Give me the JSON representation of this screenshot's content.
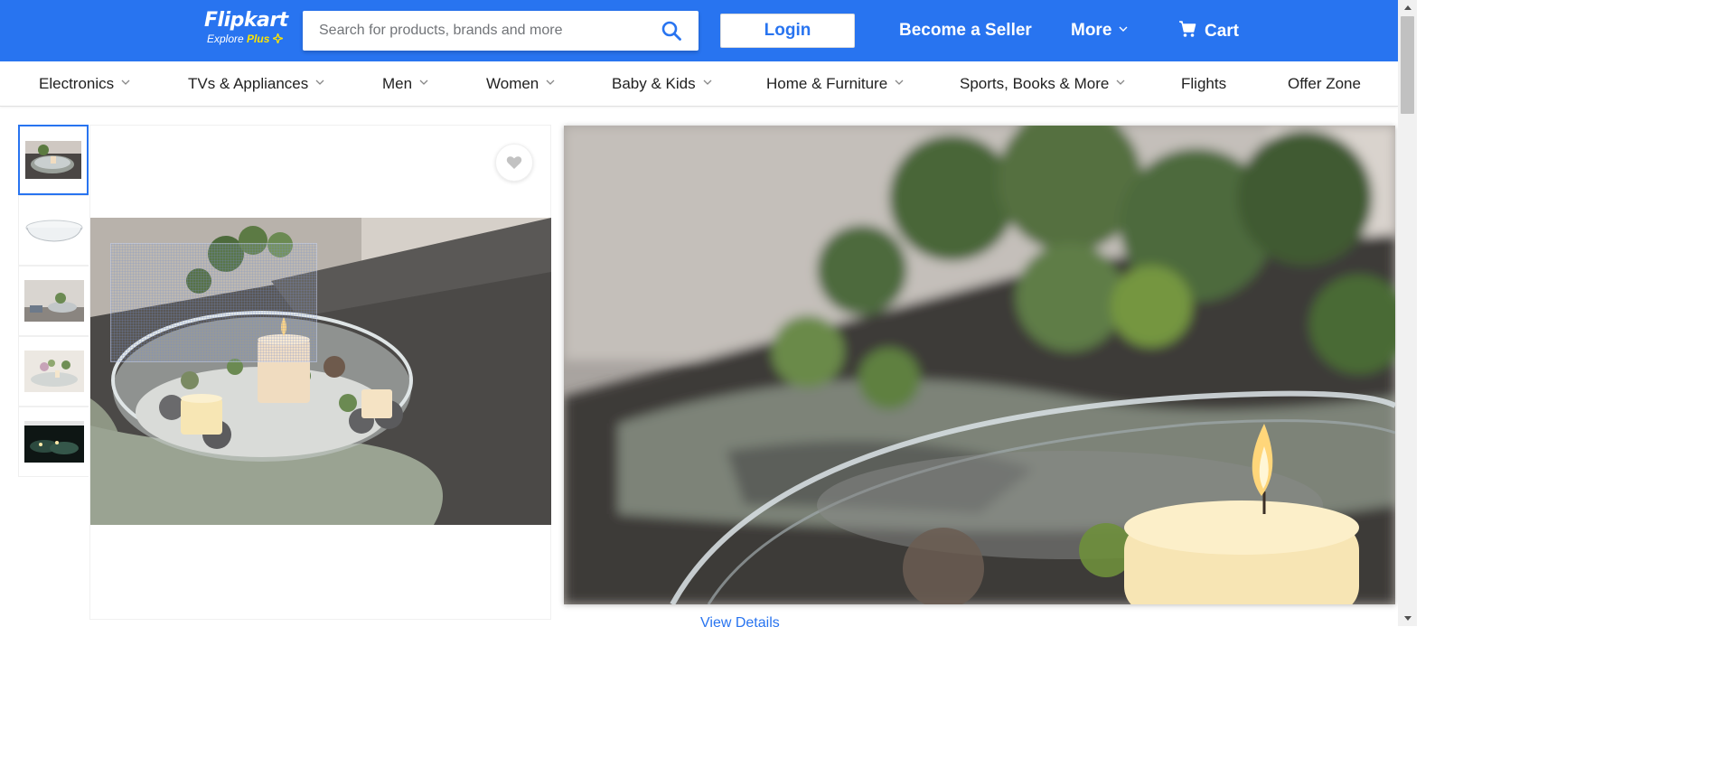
{
  "header": {
    "logo_text": "Flipkart",
    "logo_sub_explore": "Explore",
    "logo_sub_plus": "Plus",
    "search_placeholder": "Search for products, brands and more",
    "login_label": "Login",
    "become_seller_label": "Become a Seller",
    "more_label": "More",
    "cart_label": "Cart",
    "colors": {
      "brand_blue": "#2874f0",
      "plus_yellow": "#ffe500"
    }
  },
  "categories": [
    {
      "label": "Electronics",
      "has_dropdown": true
    },
    {
      "label": "TVs & Appliances",
      "has_dropdown": true
    },
    {
      "label": "Men",
      "has_dropdown": true
    },
    {
      "label": "Women",
      "has_dropdown": true
    },
    {
      "label": "Baby & Kids",
      "has_dropdown": true
    },
    {
      "label": "Home & Furniture",
      "has_dropdown": true
    },
    {
      "label": "Sports, Books & More",
      "has_dropdown": true
    },
    {
      "label": "Flights",
      "has_dropdown": false
    },
    {
      "label": "Offer Zone",
      "has_dropdown": false
    }
  ],
  "gallery": {
    "thumbnail_count": 5,
    "active_thumbnail": 1,
    "wishlist_icon": "heart-icon"
  },
  "product": {
    "view_details_label": "View Details"
  }
}
